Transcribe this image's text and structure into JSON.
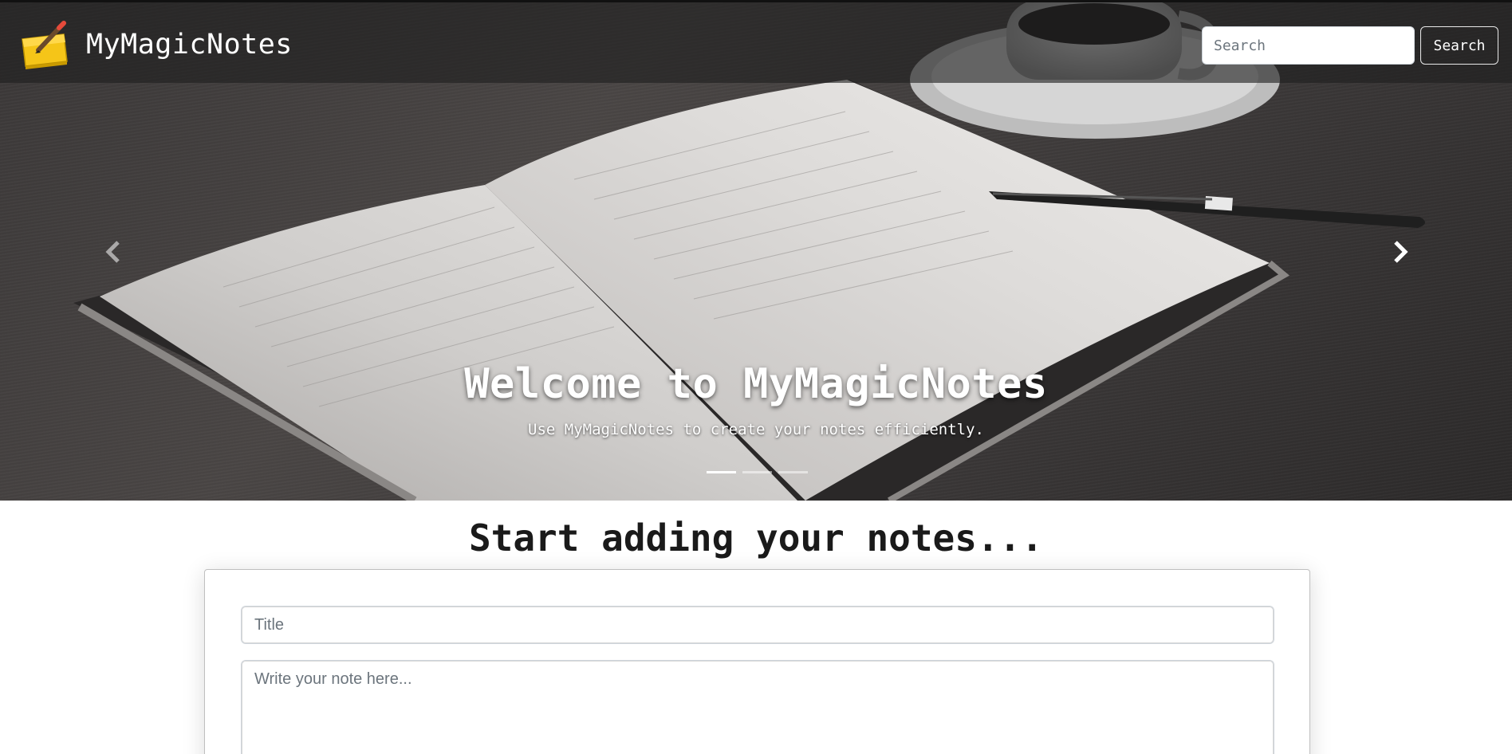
{
  "navbar": {
    "brand": "MyMagicNotes",
    "search_placeholder": "Search",
    "search_button": "Search"
  },
  "carousel": {
    "title": "Welcome to MyMagicNotes",
    "subtitle": "Use MyMagicNotes to create your notes efficiently.",
    "slides": 3,
    "active_slide": 1
  },
  "main": {
    "heading": "Start adding your notes...",
    "title_placeholder": "Title",
    "note_placeholder": "Write your note here..."
  },
  "icons": {
    "logo": "notepad-pencil-icon",
    "prev": "chevron-left-icon",
    "next": "chevron-right-icon"
  },
  "colors": {
    "navbar_bg": "#1e1e1e",
    "logo_yellow": "#f5c518",
    "text_dark": "#1a1a1a",
    "placeholder": "#6c757d"
  }
}
